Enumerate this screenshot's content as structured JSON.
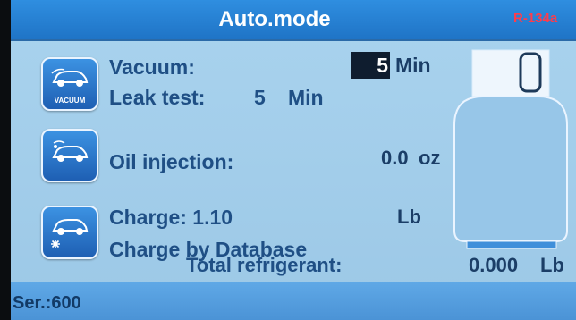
{
  "header": {
    "title": "Auto.mode",
    "refrigerant": "R-134a"
  },
  "vacuum": {
    "label": "Vacuum:",
    "value": "5",
    "unit": "Min",
    "leak_label": "Leak test:",
    "leak_value": "5",
    "leak_unit": "Min",
    "icon_label": "VACUUM"
  },
  "oil": {
    "label": "Oil injection:",
    "value": "0.0",
    "unit": "oz"
  },
  "charge": {
    "label": "Charge: 1.10",
    "unit": "Lb",
    "mode": "Charge by Database",
    "total_label": "Total refrigerant:",
    "total_value": "0.000",
    "total_unit": "Lb"
  },
  "status": {
    "serial": "Ser.:600"
  },
  "colors": {
    "title_bar": "#1f74c6",
    "screen_bg": "#a9d3ee",
    "text": "#1f4f85",
    "alert": "#ff3c4b"
  }
}
